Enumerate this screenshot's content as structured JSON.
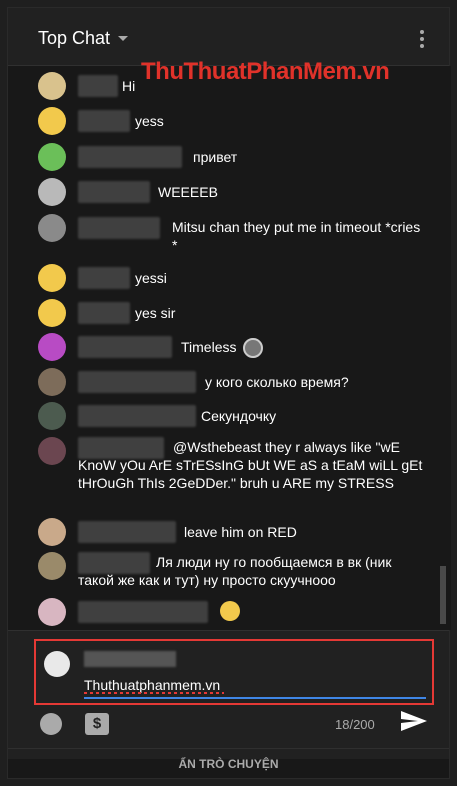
{
  "header": {
    "title": "Top Chat",
    "more": "more-options"
  },
  "watermark": "ThuThuatPhanMem.vn",
  "messages": [
    {
      "text": "Hi"
    },
    {
      "text": "yess"
    },
    {
      "text": "привет"
    },
    {
      "text": "WEEEEB"
    },
    {
      "text": "Mitsu chan they put me in timeout *cries *"
    },
    {
      "text": "yessi"
    },
    {
      "text": "yes sir"
    },
    {
      "text": "Timeless"
    },
    {
      "text": "у кого сколько время?"
    },
    {
      "text": "Секундочку"
    },
    {
      "text": "@Wsthebeast they r always like \"wE KnoW yOu ArE sTrESsInG bUt WE aS a tEaM wiLL gEt tHrOuGh ThIs 2GeDDer.\" bruh u ARE my STRESS"
    },
    {
      "text": "leave him on RED"
    },
    {
      "text": "Ля люди ну го пообщаемся в вк (ник такой же как и тут) ну просто скуучнооо"
    },
    {
      "text": ""
    }
  ],
  "composer": {
    "input_value": "Thuthuatphanmem.vn",
    "char_count": "18/200",
    "emoji": "emoji-icon",
    "super_chat": "$",
    "send": "send-icon"
  },
  "footer": {
    "hide_chat": "ẨN TRÒ CHUYỆN"
  },
  "colors": {
    "accent": "#3f86e6",
    "highlight": "#e53935",
    "watermark": "#e0322a"
  }
}
